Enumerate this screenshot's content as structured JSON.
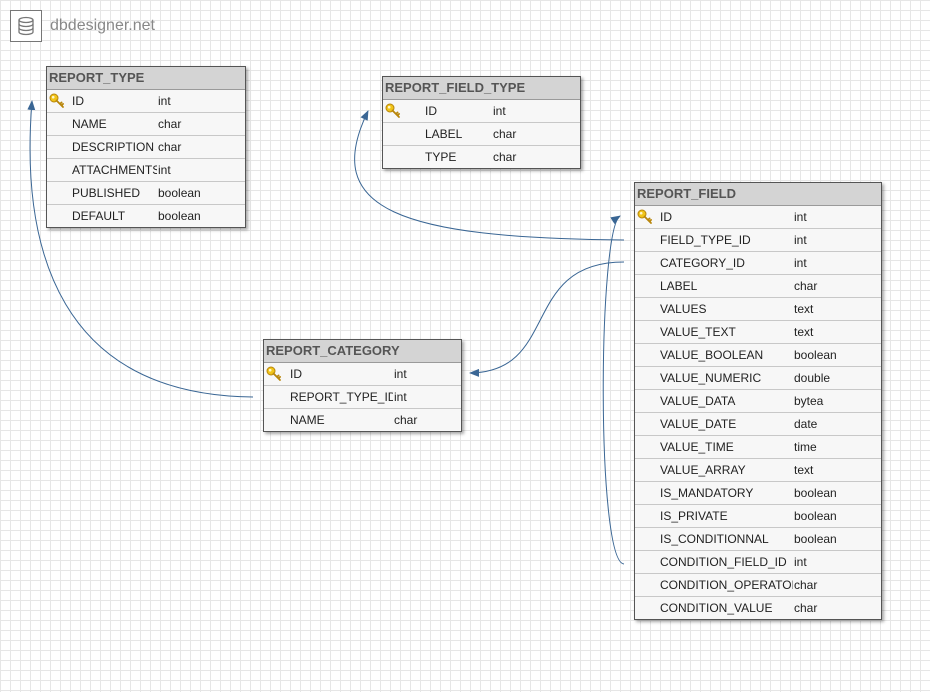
{
  "app": {
    "name": "dbdesigner.net",
    "logo_icon": "database-icon"
  },
  "colors": {
    "link": "#3a6694",
    "header_bg": "#d4d4d4",
    "key_icon": "#e8b923"
  },
  "tables": [
    {
      "name": "REPORT_TYPE",
      "fields": [
        {
          "name": "ID",
          "type": "int",
          "pk": true
        },
        {
          "name": "NAME",
          "type": "char"
        },
        {
          "name": "DESCRIPTION",
          "type": "char"
        },
        {
          "name": "ATTACHMENTS",
          "type": "int"
        },
        {
          "name": "PUBLISHED",
          "type": "boolean"
        },
        {
          "name": "DEFAULT",
          "type": "boolean"
        }
      ]
    },
    {
      "name": "REPORT_FIELD_TYPE",
      "fields": [
        {
          "name": "ID",
          "type": "int",
          "pk": true
        },
        {
          "name": "LABEL",
          "type": "char"
        },
        {
          "name": "TYPE",
          "type": "char"
        }
      ]
    },
    {
      "name": "REPORT_CATEGORY",
      "fields": [
        {
          "name": "ID",
          "type": "int",
          "pk": true
        },
        {
          "name": "REPORT_TYPE_ID",
          "type": "int"
        },
        {
          "name": "NAME",
          "type": "char"
        }
      ]
    },
    {
      "name": "REPORT_FIELD",
      "fields": [
        {
          "name": "ID",
          "type": "int",
          "pk": true
        },
        {
          "name": "FIELD_TYPE_ID",
          "type": "int"
        },
        {
          "name": "CATEGORY_ID",
          "type": "int"
        },
        {
          "name": "LABEL",
          "type": "char"
        },
        {
          "name": "VALUES",
          "type": "text"
        },
        {
          "name": "VALUE_TEXT",
          "type": "text"
        },
        {
          "name": "VALUE_BOOLEAN",
          "type": "boolean"
        },
        {
          "name": "VALUE_NUMERIC",
          "type": "double"
        },
        {
          "name": "VALUE_DATA",
          "type": "bytea"
        },
        {
          "name": "VALUE_DATE",
          "type": "date"
        },
        {
          "name": "VALUE_TIME",
          "type": "time"
        },
        {
          "name": "VALUE_ARRAY",
          "type": "text"
        },
        {
          "name": "IS_MANDATORY",
          "type": "boolean"
        },
        {
          "name": "IS_PRIVATE",
          "type": "boolean"
        },
        {
          "name": "IS_CONDITIONNAL",
          "type": "boolean"
        },
        {
          "name": "CONDITION_FIELD_ID",
          "type": "int"
        },
        {
          "name": "CONDITION_OPERATOR",
          "type": "char"
        },
        {
          "name": "CONDITION_VALUE",
          "type": "char"
        }
      ]
    }
  ],
  "relations": [
    {
      "from": "REPORT_CATEGORY.REPORT_TYPE_ID",
      "to": "REPORT_TYPE.ID"
    },
    {
      "from": "REPORT_FIELD.FIELD_TYPE_ID",
      "to": "REPORT_FIELD_TYPE.ID"
    },
    {
      "from": "REPORT_FIELD.CATEGORY_ID",
      "to": "REPORT_CATEGORY.ID"
    },
    {
      "from": "REPORT_FIELD.CONDITION_FIELD_ID",
      "to": "REPORT_FIELD.ID"
    }
  ]
}
